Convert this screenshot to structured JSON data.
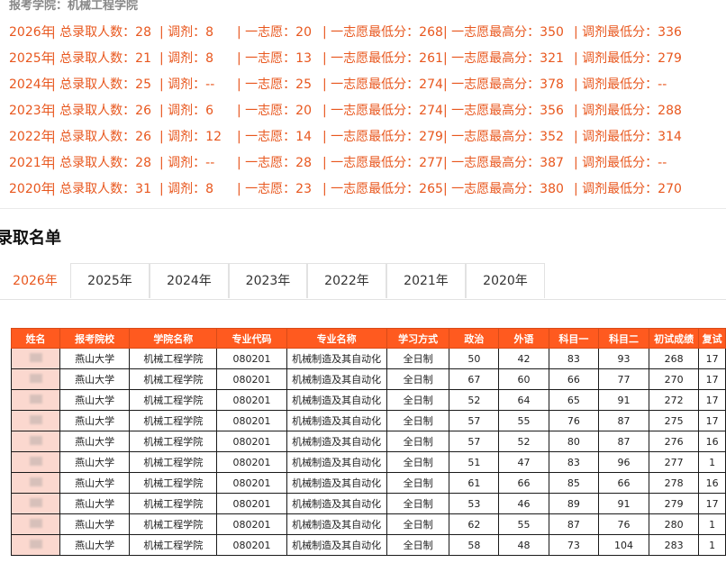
{
  "school_line": "报考学院：机械工程学院",
  "stats": [
    {
      "year": "2026年",
      "total": "总录取人数：28",
      "adjust": "调剂：8",
      "first": "一志愿：20",
      "first_min": "一志愿最低分：268",
      "first_max": "一志愿最高分：350",
      "adjust_min": "调剂最低分：336"
    },
    {
      "year": "2025年",
      "total": "总录取人数：21",
      "adjust": "调剂：8",
      "first": "一志愿：13",
      "first_min": "一志愿最低分：261",
      "first_max": "一志愿最高分：321",
      "adjust_min": "调剂最低分：279"
    },
    {
      "year": "2024年",
      "total": "总录取人数：25",
      "adjust": "调剂：--",
      "first": "一志愿：25",
      "first_min": "一志愿最低分：274",
      "first_max": "一志愿最高分：378",
      "adjust_min": "调剂最低分：--"
    },
    {
      "year": "2023年",
      "total": "总录取人数：26",
      "adjust": "调剂：6",
      "first": "一志愿：20",
      "first_min": "一志愿最低分：274",
      "first_max": "一志愿最高分：356",
      "adjust_min": "调剂最低分：288"
    },
    {
      "year": "2022年",
      "total": "总录取人数：26",
      "adjust": "调剂：12",
      "first": "一志愿：14",
      "first_min": "一志愿最低分：279",
      "first_max": "一志愿最高分：352",
      "adjust_min": "调剂最低分：314"
    },
    {
      "year": "2021年",
      "total": "总录取人数：28",
      "adjust": "调剂：--",
      "first": "一志愿：28",
      "first_min": "一志愿最低分：277",
      "first_max": "一志愿最高分：387",
      "adjust_min": "调剂最低分：--"
    },
    {
      "year": "2020年",
      "total": "总录取人数：31",
      "adjust": "调剂：8",
      "first": "一志愿：23",
      "first_min": "一志愿最低分：265",
      "first_max": "一志愿最高分：380",
      "adjust_min": "调剂最低分：270"
    }
  ],
  "section_title": "录取名单",
  "tabs": [
    "2026年",
    "2025年",
    "2024年",
    "2023年",
    "2022年",
    "2021年",
    "2020年"
  ],
  "table": {
    "headers": [
      "姓名",
      "报考院校",
      "学院名称",
      "专业代码",
      "专业名称",
      "学习方式",
      "政治",
      "外语",
      "科目一",
      "科目二",
      "初试成绩",
      "复试"
    ],
    "rows": [
      [
        "",
        "燕山大学",
        "机械工程学院",
        "080201",
        "机械制造及其自动化",
        "全日制",
        "50",
        "42",
        "83",
        "93",
        "268",
        "17"
      ],
      [
        "",
        "燕山大学",
        "机械工程学院",
        "080201",
        "机械制造及其自动化",
        "全日制",
        "67",
        "60",
        "66",
        "77",
        "270",
        "17"
      ],
      [
        "",
        "燕山大学",
        "机械工程学院",
        "080201",
        "机械制造及其自动化",
        "全日制",
        "52",
        "64",
        "65",
        "91",
        "272",
        "17"
      ],
      [
        "",
        "燕山大学",
        "机械工程学院",
        "080201",
        "机械制造及其自动化",
        "全日制",
        "57",
        "55",
        "76",
        "87",
        "275",
        "17"
      ],
      [
        "",
        "燕山大学",
        "机械工程学院",
        "080201",
        "机械制造及其自动化",
        "全日制",
        "57",
        "52",
        "80",
        "87",
        "276",
        "16"
      ],
      [
        "",
        "燕山大学",
        "机械工程学院",
        "080201",
        "机械制造及其自动化",
        "全日制",
        "51",
        "47",
        "83",
        "96",
        "277",
        "1"
      ],
      [
        "",
        "燕山大学",
        "机械工程学院",
        "080201",
        "机械制造及其自动化",
        "全日制",
        "61",
        "66",
        "85",
        "66",
        "278",
        "16"
      ],
      [
        "",
        "燕山大学",
        "机械工程学院",
        "080201",
        "机械制造及其自动化",
        "全日制",
        "53",
        "46",
        "89",
        "91",
        "279",
        "17"
      ],
      [
        "",
        "燕山大学",
        "机械工程学院",
        "080201",
        "机械制造及其自动化",
        "全日制",
        "62",
        "55",
        "87",
        "76",
        "280",
        "1"
      ],
      [
        "",
        "燕山大学",
        "机械工程学院",
        "080201",
        "机械制造及其自动化",
        "全日制",
        "58",
        "48",
        "73",
        "104",
        "283",
        "1"
      ]
    ]
  }
}
